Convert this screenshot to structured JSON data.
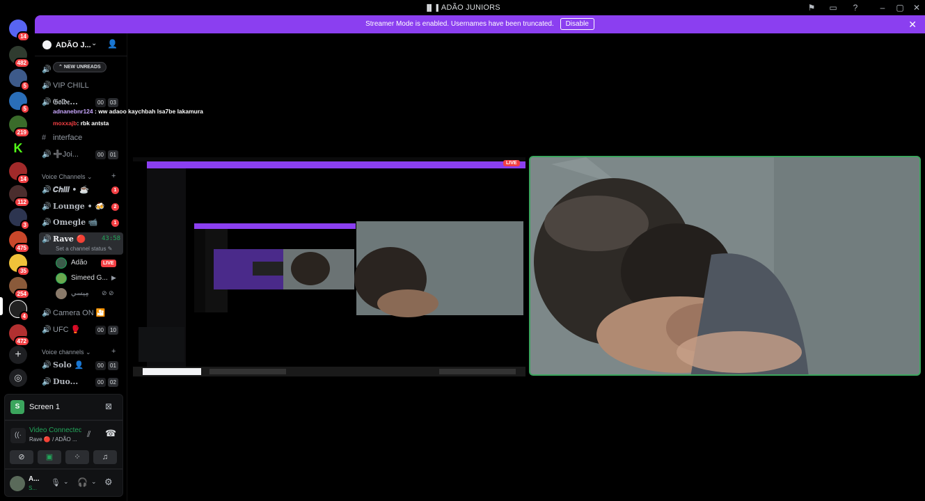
{
  "window": {
    "title": "ADÃO JUNIORS"
  },
  "banner": {
    "message": "Streamer Mode is enabled. Usernames have been truncated.",
    "disable_label": "Disable"
  },
  "rail": {
    "badges": [
      "14",
      "482",
      "5",
      "5",
      "219",
      "14",
      "112",
      "3",
      "475",
      "35",
      "254",
      "4",
      "472"
    ]
  },
  "guild": {
    "name": "ADÃO J..."
  },
  "new_unreads": "NEW UNREADS",
  "channels": {
    "vip": "VIP CHILL",
    "golden": "𝔊𝔬𝔩𝔡𝔢...",
    "golden_counts": [
      "00",
      "03"
    ],
    "interface": "interface",
    "join": "➕Joi...",
    "join_counts": [
      "00",
      "01"
    ],
    "voice_category": "Voice Channels",
    "chill": "𝑪𝒉𝒊𝒍𝒍 • ☕",
    "chill_badge": "1",
    "lounge": "Lounge • 🍻",
    "lounge_badge": "2",
    "omegle": "Omegle 📹",
    "omegle_badge": "1",
    "rave": "Rave 🔴",
    "rave_timer": "43:58",
    "rave_status": "Set a channel status",
    "camera_on": "Camera ON 🎦",
    "ufc": "UFC 🥊",
    "ufc_counts": [
      "00",
      "10"
    ],
    "voice_category2": "Voice channels",
    "solo": "Solo 👤",
    "solo_counts": [
      "00",
      "01"
    ],
    "duo": "Duo...",
    "duo_counts": [
      "00",
      "02"
    ]
  },
  "voice_users": [
    {
      "name": "Adão",
      "live": "LIVE"
    },
    {
      "name": "Simeed G..."
    },
    {
      "name": "مِيسي"
    }
  ],
  "chat_overlay": [
    {
      "user": "adnanebnr124",
      "text": " : ww adaoo kaychbah lsa7be lakamura"
    },
    {
      "user": "moxxajb",
      "text": ": rbk antsta"
    }
  ],
  "screen_panel": {
    "title": "Screen 1"
  },
  "voice_panel": {
    "status": "Video Connected",
    "channel": "Rave 🔴 / ADÃO ..."
  },
  "user_panel": {
    "name": "A...",
    "status": "S..."
  },
  "stream": {
    "live_tag": "LIVE"
  },
  "colors": {
    "accent_purple": "#8b3ff0",
    "live_red": "#f23f43",
    "speaking_green": "#3ba55d"
  }
}
